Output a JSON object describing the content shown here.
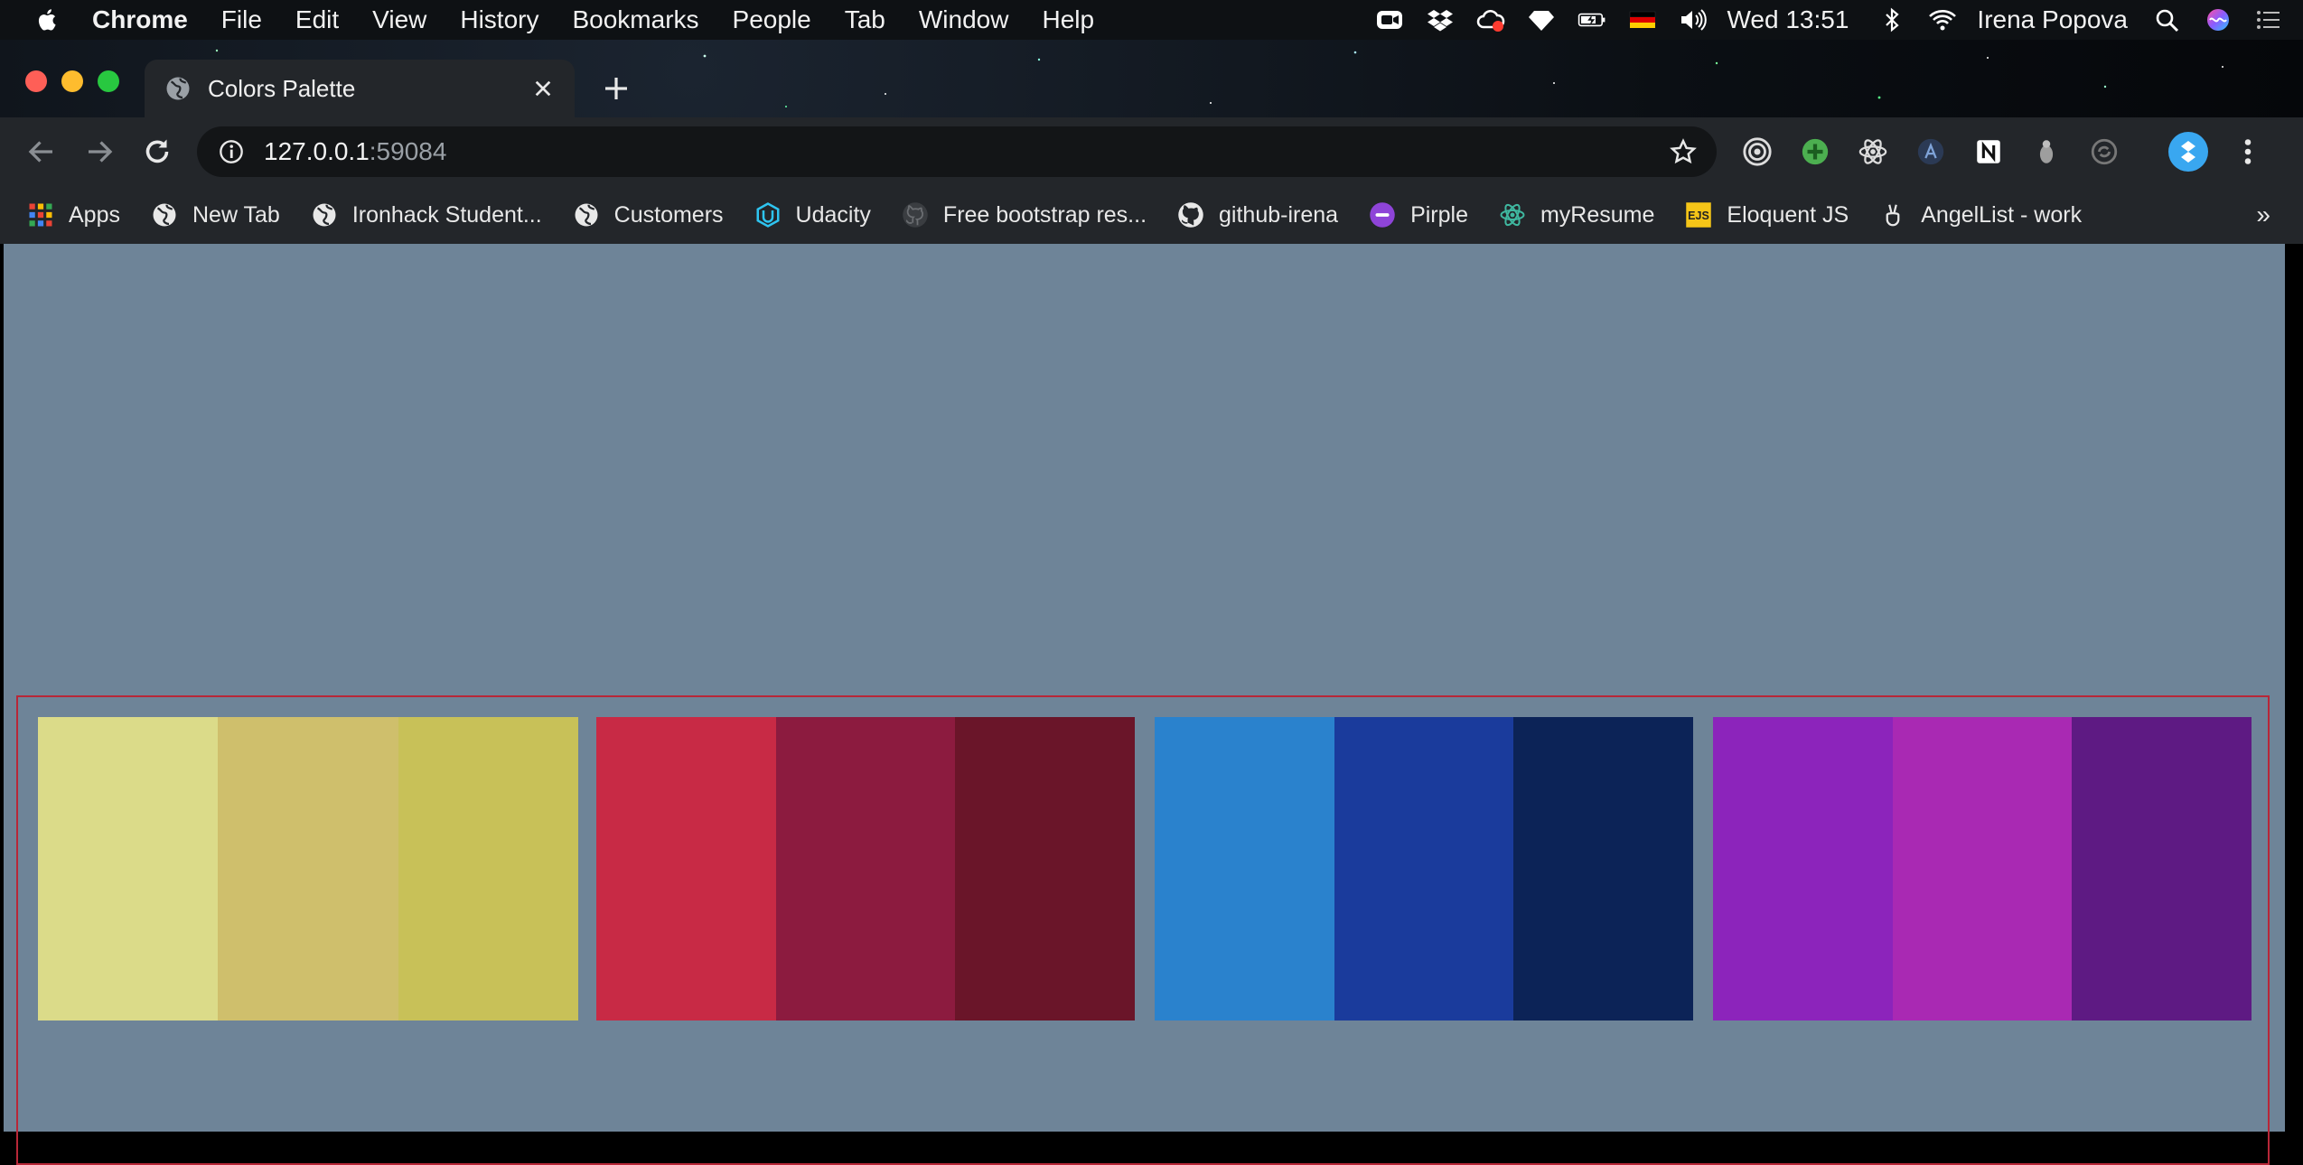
{
  "menubar": {
    "app": "Chrome",
    "items": [
      "File",
      "Edit",
      "View",
      "History",
      "Bookmarks",
      "People",
      "Tab",
      "Window",
      "Help"
    ],
    "clock": "Wed 13:51",
    "user": "Irena Popova",
    "status_icons": [
      "zoom-icon",
      "dropbox-icon",
      "creative-cloud-icon",
      "diamond-icon",
      "battery-icon",
      "german-flag-icon",
      "volume-icon",
      "bluetooth-icon",
      "wifi-icon",
      "spotlight-icon",
      "siri-icon",
      "notification-center-icon"
    ]
  },
  "tab": {
    "title": "Colors Palette"
  },
  "omnibox": {
    "host": "127.0.0.1",
    "port": ":59084"
  },
  "bookmarks": {
    "items": [
      {
        "label": "Apps",
        "icon": "apps-grid-icon"
      },
      {
        "label": "New Tab",
        "icon": "globe-icon"
      },
      {
        "label": "Ironhack Student...",
        "icon": "globe-icon"
      },
      {
        "label": "Customers",
        "icon": "globe-icon"
      },
      {
        "label": "Udacity",
        "icon": "udacity-icon"
      },
      {
        "label": "Free bootstrap res...",
        "icon": "github-icon"
      },
      {
        "label": "github-irena",
        "icon": "github-icon"
      },
      {
        "label": "Pirple",
        "icon": "pirple-icon"
      },
      {
        "label": "myResume",
        "icon": "react-icon"
      },
      {
        "label": "Eloquent JS",
        "icon": "ejs-icon"
      },
      {
        "label": "AngelList - work",
        "icon": "angellist-icon"
      }
    ],
    "more": "»"
  },
  "page": {
    "background": "#6e8498",
    "border_color": "#b82738",
    "palettes": [
      {
        "colors": [
          "#dbdb89",
          "#cfbf6c",
          "#c8c158"
        ]
      },
      {
        "colors": [
          "#c82a45",
          "#8c1b3f",
          "#6a1529"
        ]
      },
      {
        "colors": [
          "#2a82cd",
          "#1a3b9c",
          "#0c2357"
        ]
      },
      {
        "colors": [
          "#8c24bb",
          "#a929b3",
          "#5e1a83"
        ]
      }
    ]
  }
}
